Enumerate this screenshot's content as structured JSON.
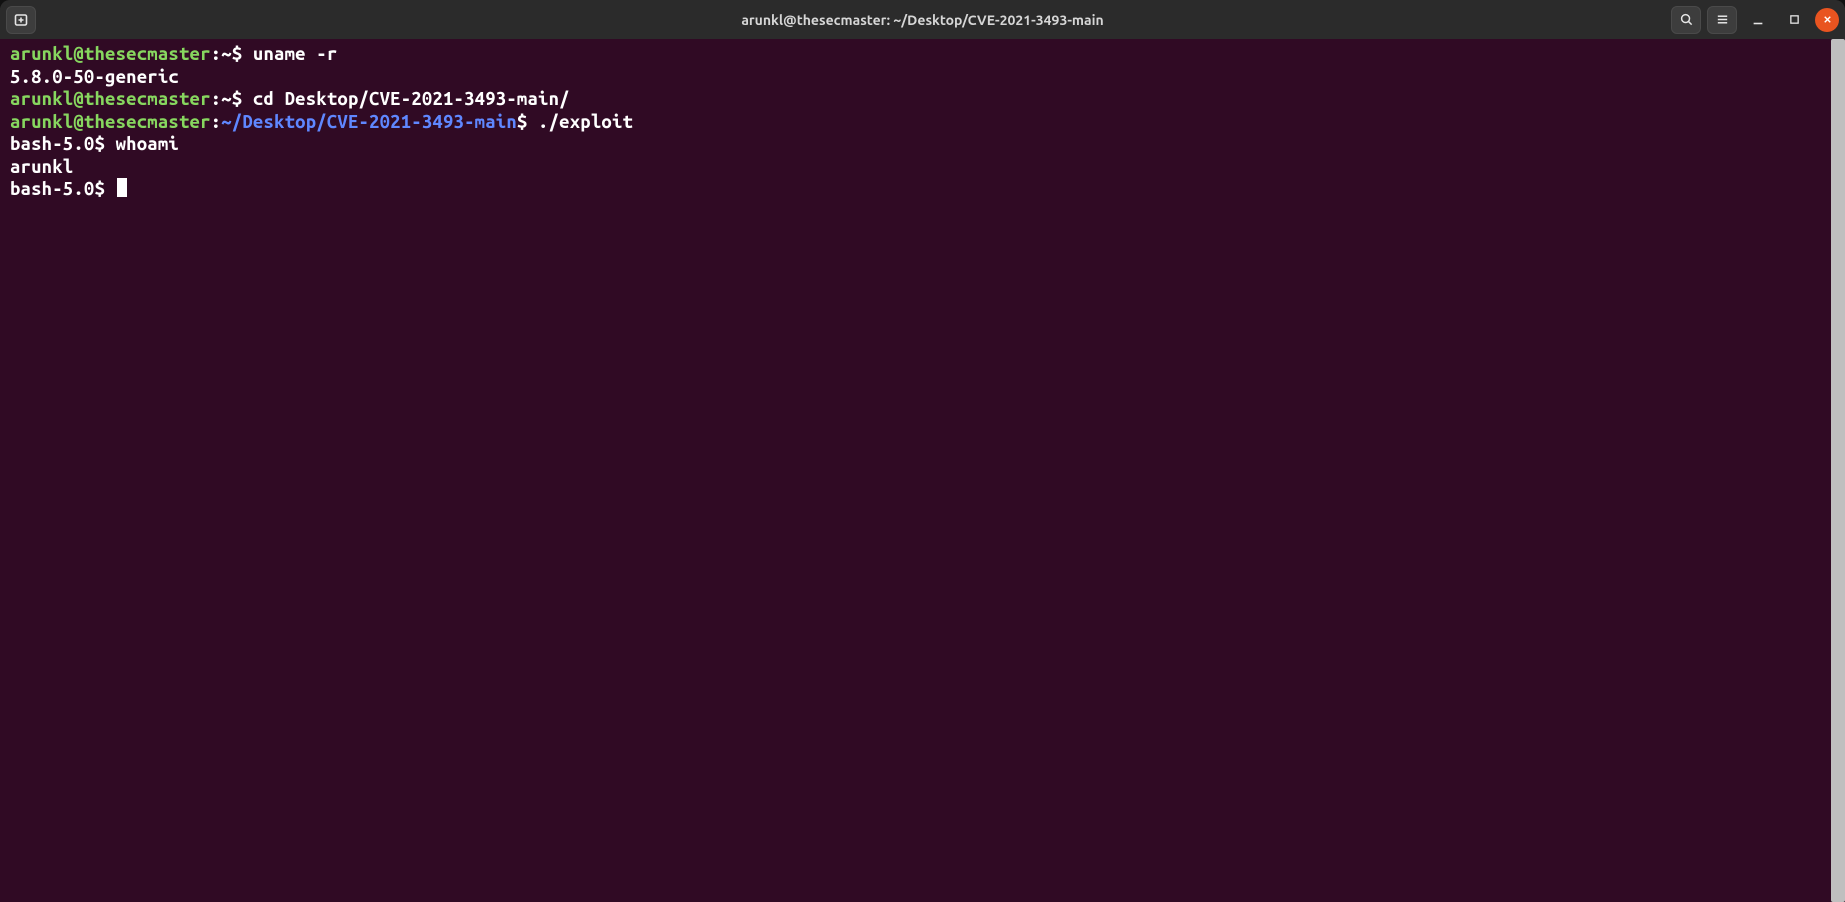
{
  "window": {
    "title": "arunkl@thesecmaster: ~/Desktop/CVE-2021-3493-main",
    "icons": {
      "new_tab": "new-tab-icon",
      "search": "search-icon",
      "menu": "hamburger-icon",
      "minimize": "minimize-icon",
      "maximize": "maximize-icon",
      "close": "close-icon"
    }
  },
  "terminal": {
    "lines": [
      {
        "type": "prompt_cmd",
        "user_host": "arunkl@thesecmaster",
        "colon": ":",
        "path": "~",
        "path_style": "home",
        "dollar": "$",
        "command": "uname -r"
      },
      {
        "type": "output",
        "text": "5.8.0-50-generic"
      },
      {
        "type": "prompt_cmd",
        "user_host": "arunkl@thesecmaster",
        "colon": ":",
        "path": "~",
        "path_style": "home",
        "dollar": "$",
        "command": "cd Desktop/CVE-2021-3493-main/"
      },
      {
        "type": "prompt_cmd",
        "user_host": "arunkl@thesecmaster",
        "colon": ":",
        "path": "~/Desktop/CVE-2021-3493-main",
        "path_style": "cwd",
        "dollar": "$",
        "command": "./exploit"
      },
      {
        "type": "bash_prompt_cmd",
        "prompt": "bash-5.0$",
        "command": "whoami"
      },
      {
        "type": "output",
        "text": "arunkl"
      },
      {
        "type": "bash_prompt_cursor",
        "prompt": "bash-5.0$"
      }
    ]
  }
}
